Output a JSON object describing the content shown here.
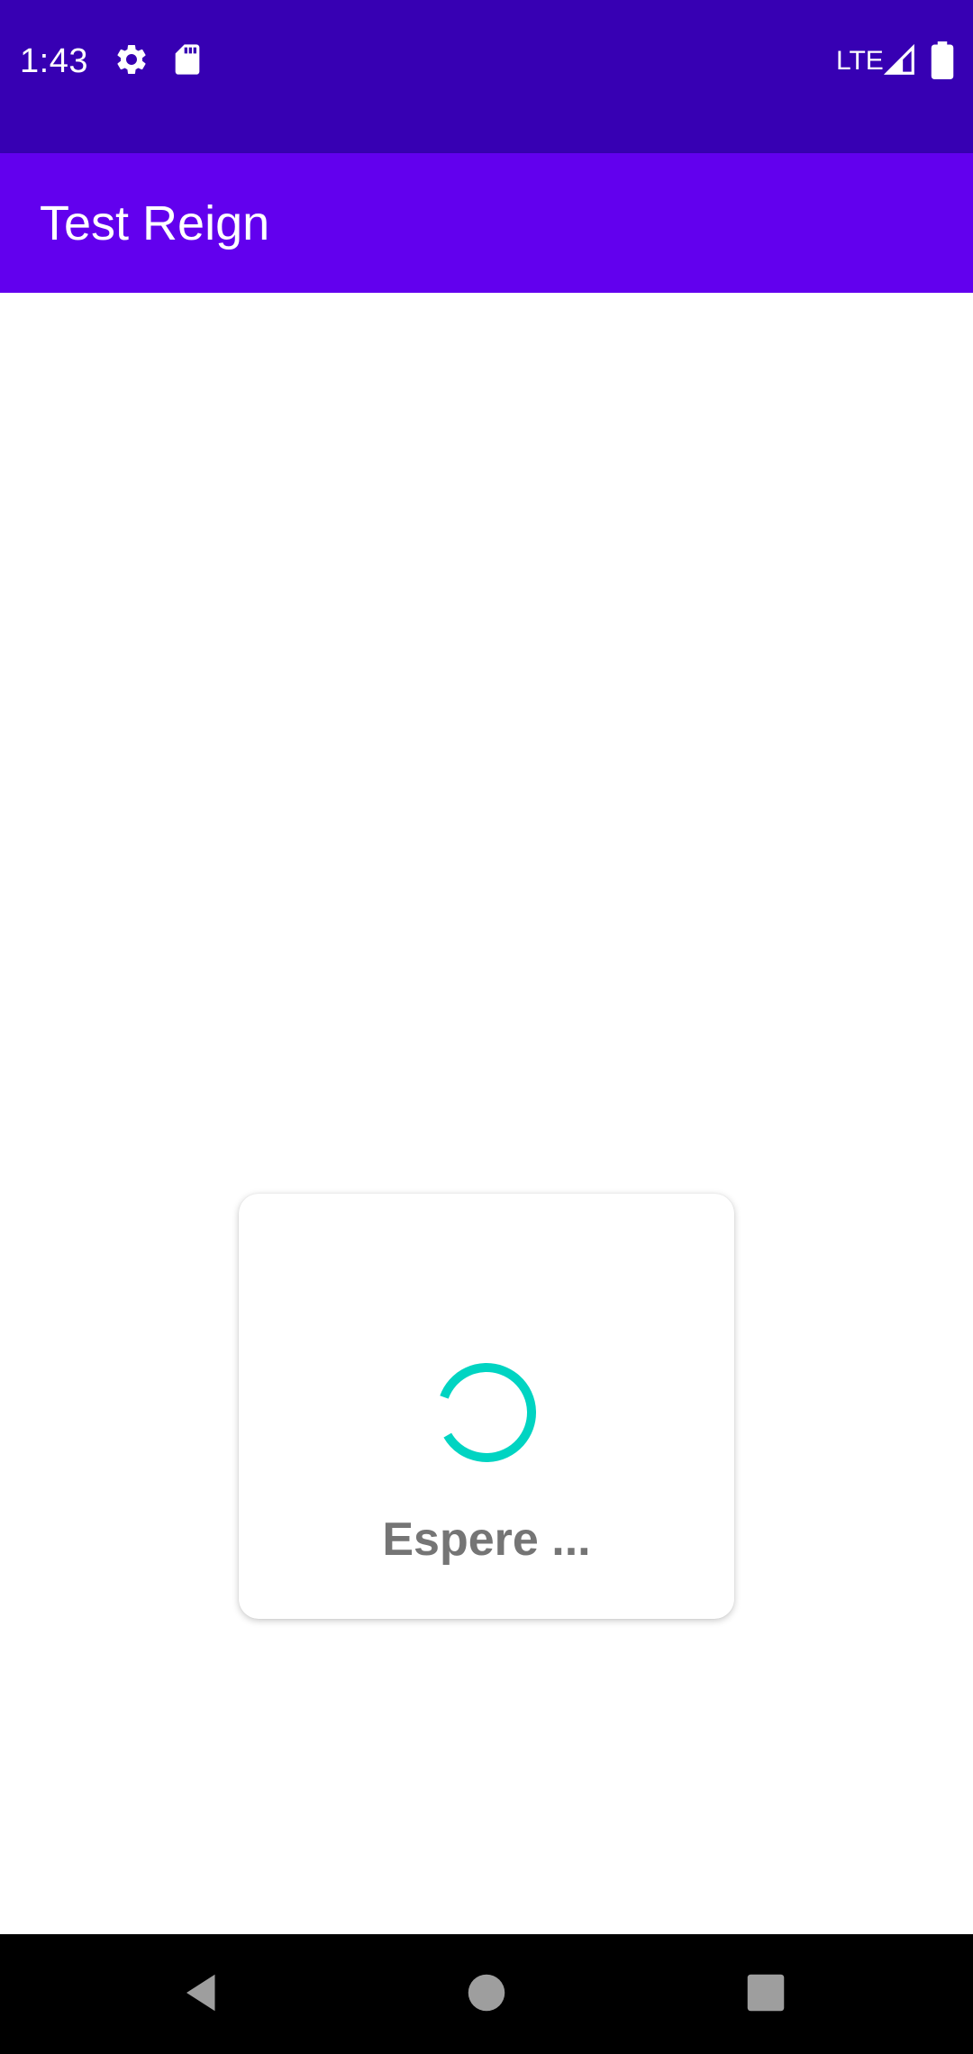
{
  "status_bar": {
    "time": "1:43",
    "network": "LTE",
    "icons": [
      "settings-icon",
      "sd-card-icon",
      "signal-icon",
      "battery-icon"
    ],
    "background": "#3700b3"
  },
  "app_bar": {
    "title": "Test Reign",
    "background": "#6200ee"
  },
  "loading_dialog": {
    "message": "Espere ...",
    "spinner_color": "#00d4c2",
    "text_color": "#757575"
  },
  "nav_bar": {
    "buttons": [
      "back-icon",
      "home-icon",
      "recents-icon"
    ]
  }
}
